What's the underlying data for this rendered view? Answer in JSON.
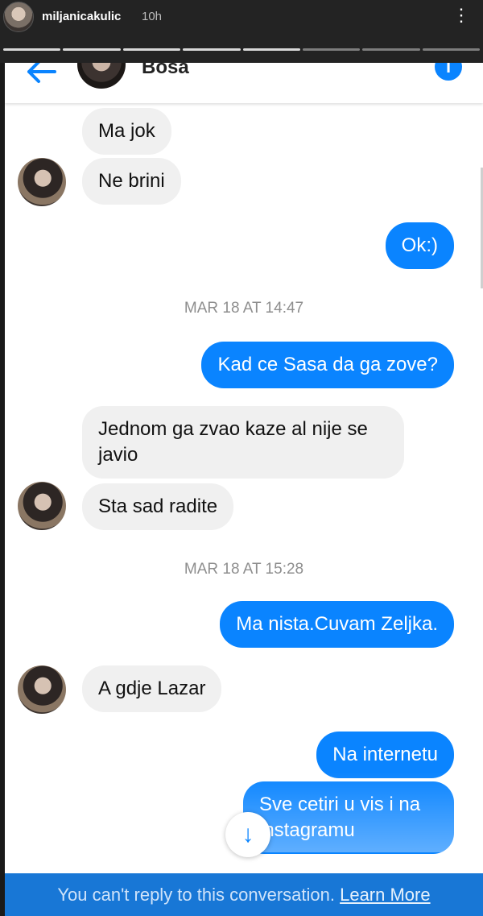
{
  "story": {
    "username": "miljanicakulic",
    "time": "10h",
    "more_icon": "more-dots-icon"
  },
  "header": {
    "contact_name": "Bosa",
    "back_icon": "back-arrow-icon",
    "info_icon": "info-icon",
    "info_glyph": "i"
  },
  "messages": [
    {
      "from": "contact",
      "text": "Ma jok"
    },
    {
      "from": "contact",
      "text": "Ne brini"
    },
    {
      "from": "me",
      "text": "Ok:)"
    },
    {
      "type": "timestamp",
      "text": "MAR 18 AT 14:47"
    },
    {
      "from": "me",
      "text": "Kad ce Sasa da ga zove?"
    },
    {
      "from": "contact",
      "text": "Jednom ga zvao kaze al nije se javio"
    },
    {
      "from": "contact",
      "text": "Sta sad radite"
    },
    {
      "type": "timestamp",
      "text": "MAR 18 AT 15:28"
    },
    {
      "from": "me",
      "text": "Ma nista.Cuvam Zeljka."
    },
    {
      "from": "contact",
      "text": "A gdje Lazar"
    },
    {
      "from": "me",
      "text": "Na internetu"
    },
    {
      "from": "me",
      "text": "Sve cetiri u vis i na instagramu"
    }
  ],
  "footer": {
    "notice": "You can't reply to this conversation.",
    "link": "Learn More",
    "scroll_icon": "arrow-down-icon"
  },
  "colors": {
    "outgoing_bubble": "#0a84ff",
    "incoming_bubble": "#f0f0f0",
    "reply_bar": "#1877d6"
  }
}
